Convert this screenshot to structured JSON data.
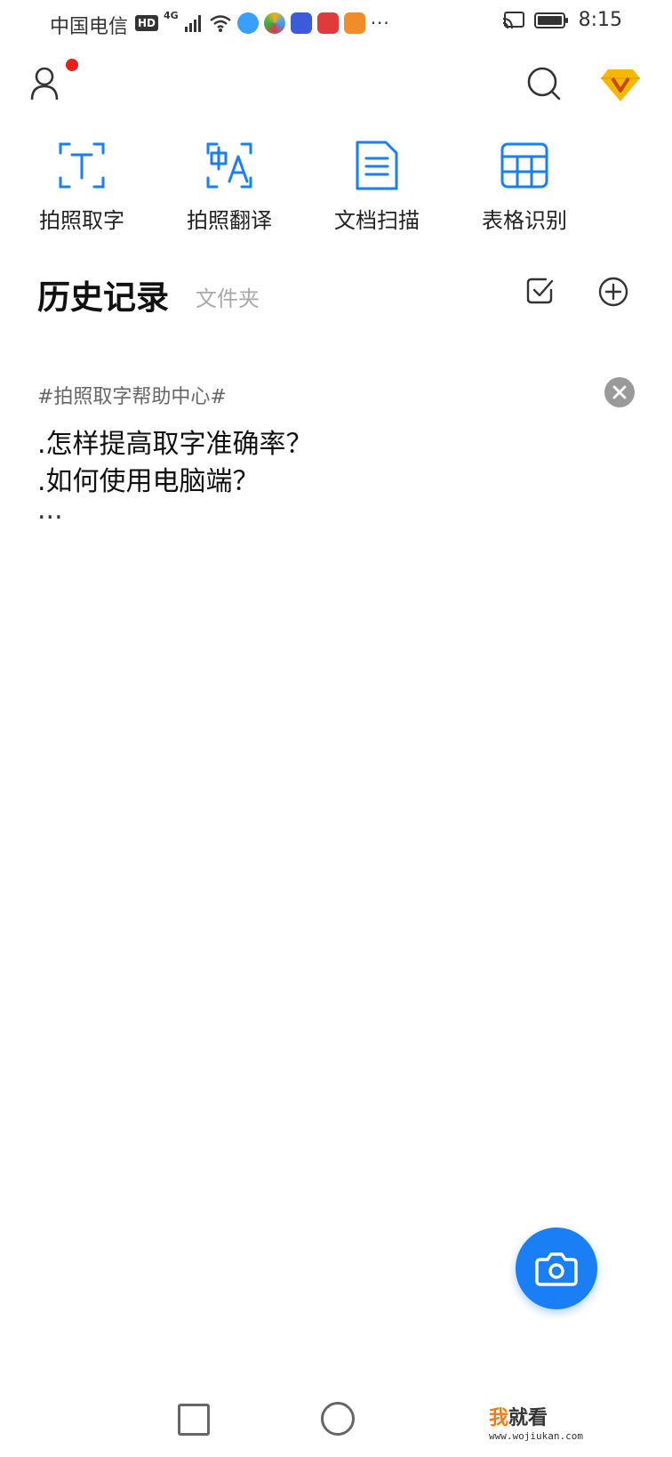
{
  "status_bar": {
    "carrier": "中国电信",
    "hd": "HD",
    "network": "4G",
    "more": "···",
    "time": "8:15",
    "app_icon_colors": [
      "#3aa0ff",
      "#f2b01e",
      "#3b5bdb",
      "#e03b3b",
      "#f08c2a"
    ]
  },
  "header": {
    "user_icon": "user-icon",
    "search_icon": "search-icon",
    "vip_icon": "vip-diamond-icon",
    "vip_color": "#f5b800"
  },
  "features": [
    {
      "label": "拍照取字",
      "icon": "text-capture-icon"
    },
    {
      "label": "拍照翻译",
      "icon": "translate-icon"
    },
    {
      "label": "文档扫描",
      "icon": "document-scan-icon"
    },
    {
      "label": "表格识别",
      "icon": "table-recognition-icon"
    }
  ],
  "accent_color": "#1a7ff5",
  "section": {
    "history_tab": "历史记录",
    "folder_tab": "文件夹",
    "check_icon": "select-check-icon",
    "add_icon": "add-circle-icon"
  },
  "help_card": {
    "tag": "#拍照取字帮助中心#",
    "lines": [
      ".怎样提高取字准确率？",
      ".如何使用电脑端？",
      "..."
    ],
    "close_icon": "close-icon"
  },
  "fab": {
    "icon": "camera-icon"
  },
  "navbar": {
    "recent_icon": "recent-apps-icon",
    "home_icon": "home-icon"
  },
  "watermark": {
    "brand_first": "我",
    "brand_rest": "就看",
    "url": "www.wojiukan.com"
  }
}
